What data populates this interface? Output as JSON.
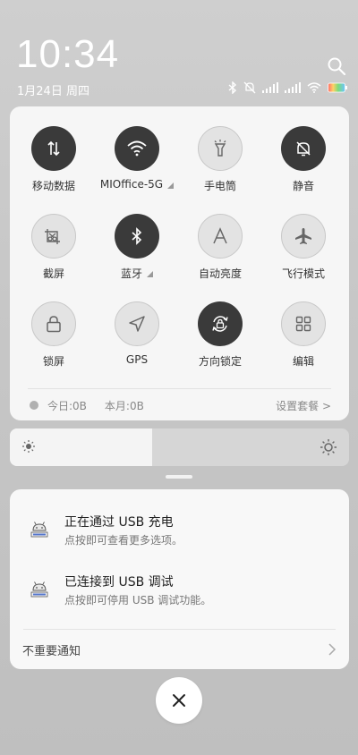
{
  "status": {
    "time": "10:34",
    "date": "1月24日 周四"
  },
  "quick_settings": {
    "tiles": [
      {
        "label": "移动数据",
        "state": "on",
        "icon": "data-arrows-icon"
      },
      {
        "label": "MIOffice-5G",
        "state": "on",
        "icon": "wifi-icon",
        "expandable": true
      },
      {
        "label": "手电筒",
        "state": "off",
        "icon": "flashlight-icon"
      },
      {
        "label": "静音",
        "state": "on",
        "icon": "bell-muted-icon"
      },
      {
        "label": "截屏",
        "state": "off",
        "icon": "screenshot-icon"
      },
      {
        "label": "蓝牙",
        "state": "on",
        "icon": "bluetooth-icon",
        "expandable": true
      },
      {
        "label": "自动亮度",
        "state": "off",
        "icon": "auto-brightness-icon"
      },
      {
        "label": "飞行模式",
        "state": "off",
        "icon": "airplane-icon"
      },
      {
        "label": "锁屏",
        "state": "off",
        "icon": "lock-icon"
      },
      {
        "label": "GPS",
        "state": "off",
        "icon": "gps-icon"
      },
      {
        "label": "方向锁定",
        "state": "on",
        "icon": "rotation-lock-icon"
      },
      {
        "label": "编辑",
        "state": "off",
        "icon": "grid-edit-icon"
      }
    ],
    "data_usage": {
      "today": "今日:0B",
      "month": "本月:0B",
      "plan_link": "设置套餐 >"
    }
  },
  "brightness": {
    "level": 0.42
  },
  "notifications": [
    {
      "title": "正在通过 USB 充电",
      "body": "点按即可查看更多选项。",
      "icon": "android-usb-icon"
    },
    {
      "title": "已连接到 USB 调试",
      "body": "点按即可停用 USB 调试功能。",
      "icon": "android-usb-icon"
    }
  ],
  "unimportant_label": "不重要通知",
  "colors": {
    "tile_on": "#3a3a3a",
    "tile_off": "#e3e3e3",
    "panel": "#f6f6f6"
  }
}
